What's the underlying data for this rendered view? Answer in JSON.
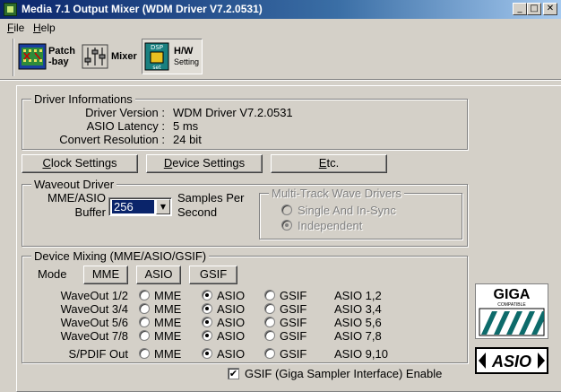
{
  "window": {
    "title": "Media 7.1 Output Mixer (WDM Driver V7.2.0531)"
  },
  "menu": {
    "file": "File",
    "file_key": "F",
    "file_rest": "ile",
    "help": "Help",
    "help_key": "H",
    "help_rest": "elp"
  },
  "toolbar": {
    "patchbay_line1": "Patch",
    "patchbay_line2": "-bay",
    "mixer": "Mixer",
    "hw_line1": "H/W",
    "hw_line2": "Setting",
    "hw_icon_text1": "DSP",
    "hw_icon_text2": "set"
  },
  "driver_info": {
    "legend": "Driver Informations",
    "version_label": "Driver Version :",
    "version_value": "WDM Driver V7.2.0531",
    "latency_label": "ASIO Latency :",
    "latency_value": "5 ms",
    "resolution_label": "Convert Resolution :",
    "resolution_value": "24 bit"
  },
  "buttons": {
    "clock_key": "C",
    "clock_rest": "lock Settings",
    "device_key": "D",
    "device_rest": "evice Settings",
    "etc_key": "E",
    "etc_rest": "tc."
  },
  "waveout": {
    "legend": "Waveout Driver",
    "buffer_line1": "MME/ASIO",
    "buffer_line2": "Buffer",
    "buffer_value": "256",
    "samples_line1": "Samples Per",
    "samples_line2": "Second",
    "multitrack": {
      "legend": "Multi-Track Wave Drivers",
      "option1": "Single And In-Sync",
      "option2": "Independent",
      "selected": "Independent"
    }
  },
  "device_mixing": {
    "legend": "Device Mixing (MME/ASIO/GSIF)",
    "mode_label": "Mode",
    "mode_buttons": [
      "MME",
      "ASIO",
      "GSIF"
    ],
    "option_labels": [
      "MME",
      "ASIO",
      "GSIF"
    ],
    "rows": [
      {
        "name": "WaveOut 1/2",
        "selected": "ASIO",
        "assignment": "ASIO 1,2"
      },
      {
        "name": "WaveOut 3/4",
        "selected": "ASIO",
        "assignment": "ASIO 3,4"
      },
      {
        "name": "WaveOut 5/6",
        "selected": "ASIO",
        "assignment": "ASIO 5,6"
      },
      {
        "name": "WaveOut 7/8",
        "selected": "ASIO",
        "assignment": "ASIO 7,8"
      },
      {
        "name": "S/PDIF Out",
        "selected": "ASIO",
        "assignment": "ASIO 9,10"
      }
    ]
  },
  "gsif": {
    "label": "GSIF (Giga Sampler Interface) Enable",
    "checked": true,
    "check_glyph": "✔"
  },
  "logos": {
    "giga_text": "GIGA",
    "giga_sub": "COMPATIBLE",
    "asio_text": "ASIO"
  }
}
